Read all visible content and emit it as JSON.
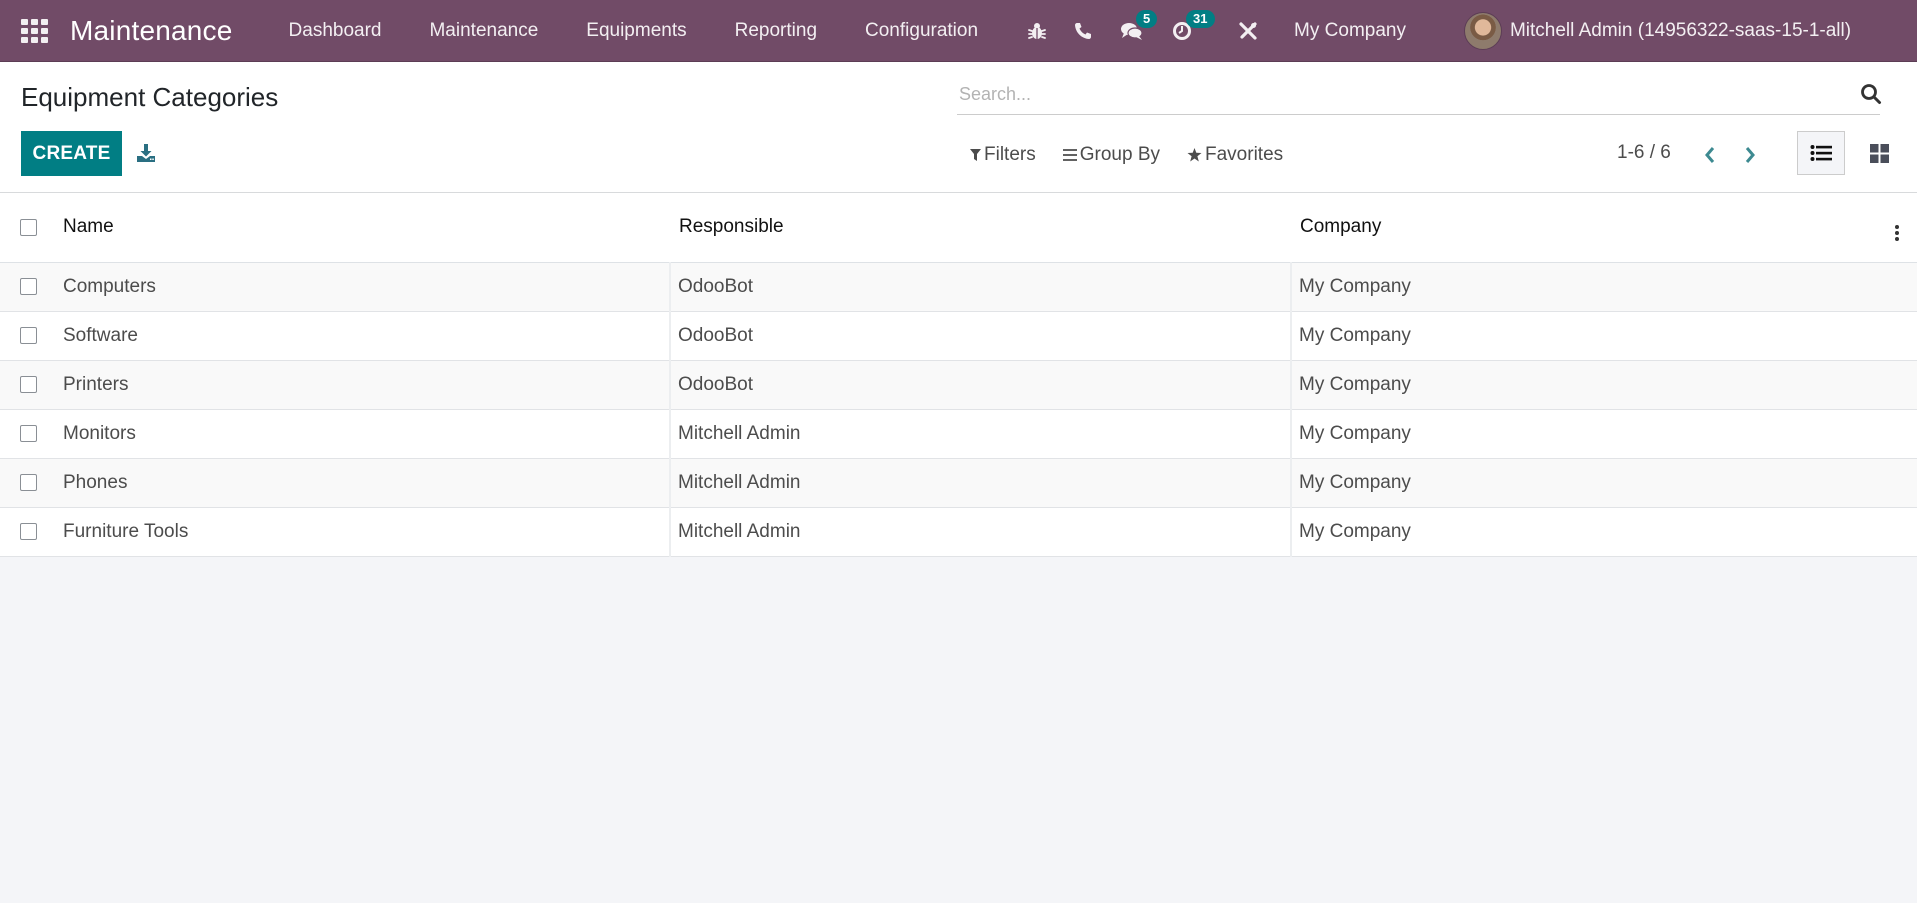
{
  "navbar": {
    "app_name": "Maintenance",
    "menu": [
      "Dashboard",
      "Maintenance",
      "Equipments",
      "Reporting",
      "Configuration"
    ],
    "systray": {
      "debug_icon": "bug-icon",
      "phone_icon": "phone-icon",
      "messages_icon": "chat-bubbles-icon",
      "messages_count": "5",
      "activities_icon": "clock-icon",
      "activities_count": "31",
      "settings_icon": "tools-icon"
    },
    "company": "My Company",
    "user": "Mitchell Admin (14956322-saas-15-1-all)"
  },
  "control_panel": {
    "title": "Equipment Categories",
    "create_label": "CREATE",
    "search_placeholder": "Search...",
    "search_value": "",
    "filters_label": "Filters",
    "group_by_label": "Group By",
    "favorites_label": "Favorites",
    "pager": "1-6 / 6",
    "active_view": "list"
  },
  "table": {
    "columns": [
      "Name",
      "Responsible",
      "Company"
    ],
    "rows": [
      {
        "name": "Computers",
        "responsible": "OdooBot",
        "company": "My Company"
      },
      {
        "name": "Software",
        "responsible": "OdooBot",
        "company": "My Company"
      },
      {
        "name": "Printers",
        "responsible": "OdooBot",
        "company": "My Company"
      },
      {
        "name": "Monitors",
        "responsible": "Mitchell Admin",
        "company": "My Company"
      },
      {
        "name": "Phones",
        "responsible": "Mitchell Admin",
        "company": "My Company"
      },
      {
        "name": "Furniture Tools",
        "responsible": "Mitchell Admin",
        "company": "My Company"
      }
    ]
  },
  "colors": {
    "navbar": "#714b67",
    "primary": "#017e84",
    "badge": "#017e84",
    "pager_arrows": "#017e84"
  }
}
